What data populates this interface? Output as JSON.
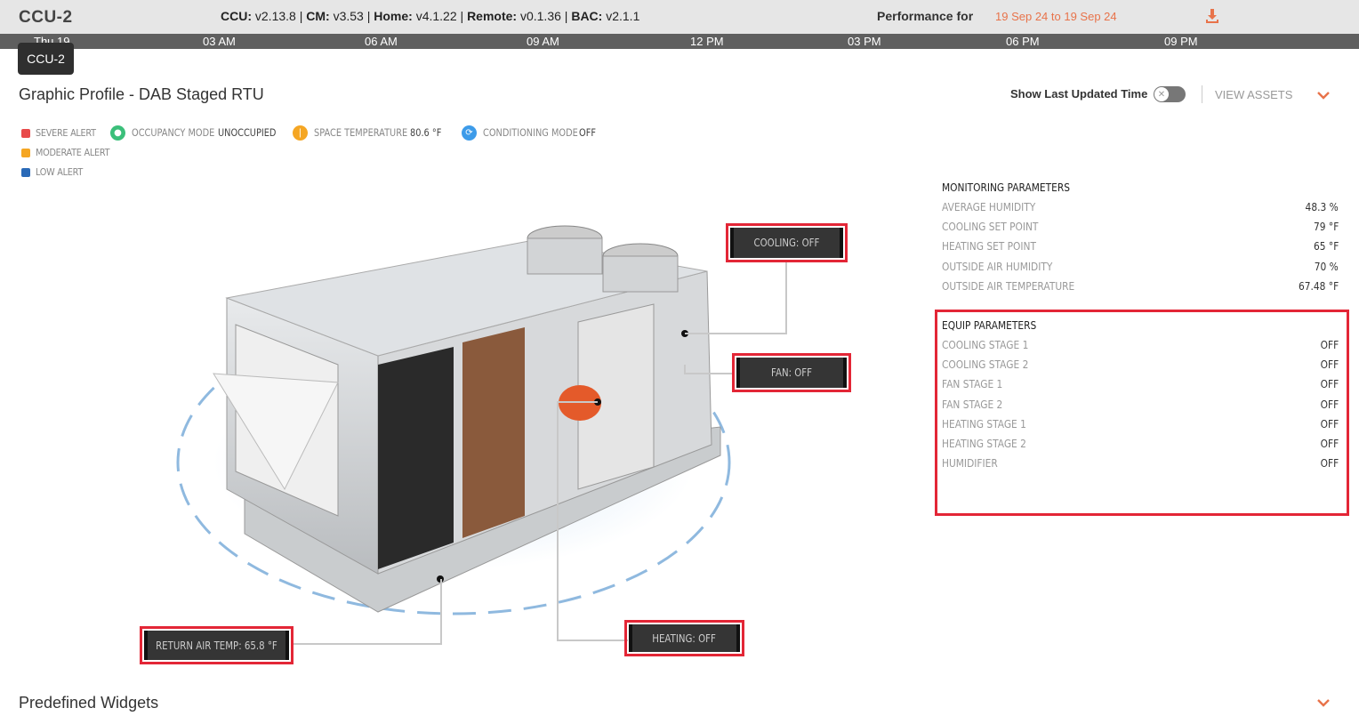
{
  "header": {
    "title": "CCU-2",
    "versions": [
      {
        "label": "CCU:",
        "value": "v2.13.8"
      },
      {
        "label": "CM:",
        "value": "v3.53"
      },
      {
        "label": "Home:",
        "value": "v4.1.22"
      },
      {
        "label": "Remote:",
        "value": "v0.1.36"
      },
      {
        "label": "BAC:",
        "value": "v2.1.1"
      }
    ],
    "performance_label": "Performance for",
    "date_range": "19 Sep 24 to 19 Sep 24"
  },
  "timeline": {
    "labels": [
      "Thu 19",
      "03 AM",
      "06 AM",
      "09 AM",
      "12 PM",
      "03 PM",
      "06 PM",
      "09 PM"
    ]
  },
  "tooltip": "CCU-2",
  "profile": {
    "title": "Graphic Profile - DAB Staged RTU",
    "show_last_updated": "Show Last Updated Time",
    "toggle_on": false,
    "view_assets": "VIEW ASSETS"
  },
  "legend": [
    {
      "label": "SEVERE ALERT",
      "color": "#e84a4a"
    },
    {
      "label": "MODERATE ALERT",
      "color": "#f5a623"
    },
    {
      "label": "LOW ALERT",
      "color": "#2a6ab8"
    }
  ],
  "modes": [
    {
      "label": "OCCUPANCY MODE",
      "value": "UNOCCUPIED",
      "icon": "person-icon",
      "color": "#3bbf7a"
    },
    {
      "label": "SPACE TEMPERATURE",
      "value": "80.6 °F",
      "icon": "thermometer-icon",
      "color": "#f5a623"
    },
    {
      "label": "CONDITIONING MODE",
      "value": "OFF",
      "icon": "sync-icon",
      "color": "#3d9be9"
    }
  ],
  "monitoring": {
    "title": "MONITORING PARAMETERS",
    "rows": [
      {
        "name": "AVERAGE HUMIDITY",
        "value": "48.3 %"
      },
      {
        "name": "COOLING SET POINT",
        "value": "79 °F"
      },
      {
        "name": "HEATING SET POINT",
        "value": "65 °F"
      },
      {
        "name": "OUTSIDE AIR HUMIDITY",
        "value": "70 %"
      },
      {
        "name": "OUTSIDE AIR TEMPERATURE",
        "value": "67.48 °F"
      }
    ]
  },
  "equip": {
    "title": "EQUIP PARAMETERS",
    "rows": [
      {
        "name": "COOLING STAGE 1",
        "value": "OFF"
      },
      {
        "name": "COOLING STAGE 2",
        "value": "OFF"
      },
      {
        "name": "FAN STAGE 1",
        "value": "OFF"
      },
      {
        "name": "FAN STAGE 2",
        "value": "OFF"
      },
      {
        "name": "HEATING STAGE 1",
        "value": "OFF"
      },
      {
        "name": "HEATING STAGE 2",
        "value": "OFF"
      },
      {
        "name": "HUMIDIFIER",
        "value": "OFF"
      }
    ]
  },
  "callouts": {
    "cooling": "COOLING: OFF",
    "fan": "FAN: OFF",
    "heating": "HEATING: OFF",
    "return_air": "RETURN AIR TEMP: 65.8 °F"
  },
  "footer": {
    "predefined_widgets": "Predefined Widgets"
  },
  "colors": {
    "accent": "#e8734a",
    "highlight": "#e32636"
  }
}
